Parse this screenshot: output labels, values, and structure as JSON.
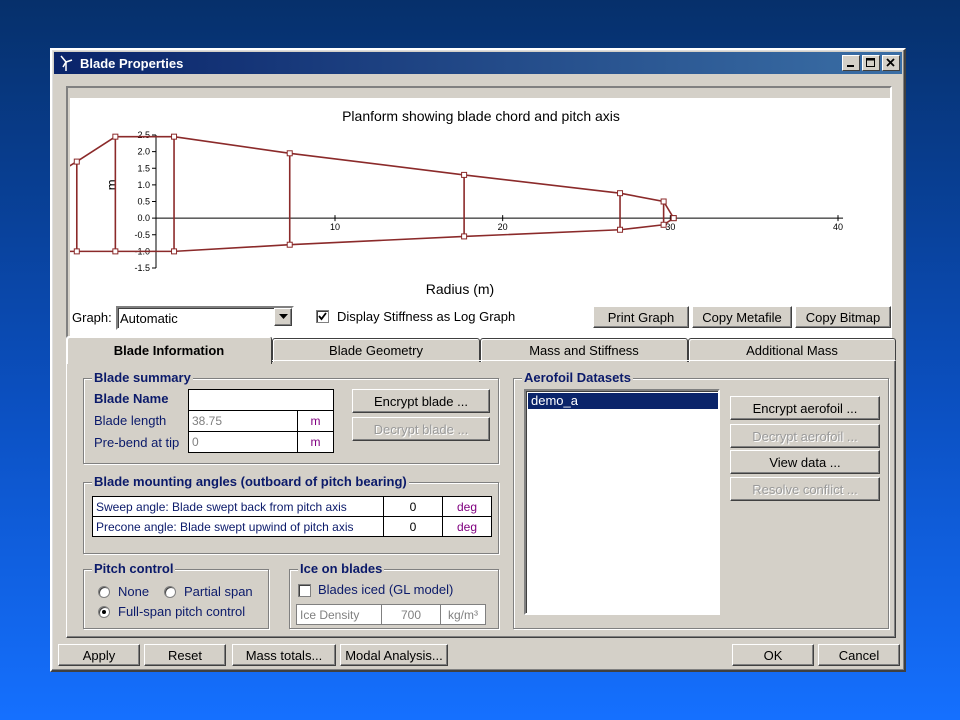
{
  "window": {
    "title": "Blade Properties"
  },
  "chart_data": {
    "type": "line",
    "title": "Planform showing blade chord and pitch axis",
    "xlabel": "Radius (m)",
    "ylabel": "m",
    "xlim": [
      0,
      40
    ],
    "ylim": [
      -1.5,
      2.5
    ],
    "x_ticks": [
      "10",
      "20",
      "30",
      "40"
    ],
    "y_ticks": [
      "2.5",
      "2.0",
      "1.5",
      "1.0",
      "0.5",
      "0.0",
      "-0.5",
      "-1.0",
      "-1.5"
    ],
    "series": [
      {
        "values": [
          [
            -8.8,
            1.0
          ],
          [
            -7.7,
            1.0
          ],
          [
            -5.4,
            1.7
          ],
          [
            -3.1,
            2.45
          ],
          [
            0.4,
            2.45
          ],
          [
            7.3,
            1.95
          ],
          [
            17.7,
            1.3
          ],
          [
            27.0,
            0.75
          ],
          [
            29.6,
            0.5
          ],
          [
            30.2,
            0.0
          ]
        ]
      },
      {
        "values": [
          [
            -8.8,
            -1.0
          ],
          [
            -7.7,
            -1.0
          ],
          [
            -5.4,
            -1.0
          ],
          [
            -3.1,
            -1.0
          ],
          [
            0.4,
            -1.0
          ],
          [
            7.3,
            -0.8
          ],
          [
            17.7,
            -0.55
          ],
          [
            27.0,
            -0.35
          ],
          [
            29.6,
            -0.2
          ],
          [
            30.2,
            0.0
          ]
        ]
      }
    ],
    "grid": false
  },
  "graph": {
    "label": "Graph:",
    "dropdown_value": "Automatic",
    "log_checkbox_label": "Display Stiffness as Log Graph",
    "log_checked": true,
    "print_button": "Print Graph",
    "copy_metafile_button": "Copy Metafile",
    "copy_bitmap_button": "Copy Bitmap"
  },
  "tabs": [
    "Blade Information",
    "Blade Geometry",
    "Mass and Stiffness",
    "Additional Mass"
  ],
  "blade_summary": {
    "title": "Blade summary",
    "name_label": "Blade Name",
    "name_value": "",
    "length_label": "Blade length",
    "length_value": "38.75",
    "length_unit": "m",
    "prebend_label": "Pre-bend at tip",
    "prebend_value": "0",
    "prebend_unit": "m",
    "encrypt_button": "Encrypt blade ...",
    "decrypt_button": "Decrypt blade ..."
  },
  "mounting": {
    "title": "Blade mounting angles (outboard of pitch bearing)",
    "sweep_label": "Sweep angle: Blade swept back from pitch axis",
    "sweep_value": "0",
    "sweep_unit": "deg",
    "precone_label": "Precone angle: Blade swept upwind of pitch axis",
    "precone_value": "0",
    "precone_unit": "deg"
  },
  "pitch_control": {
    "title": "Pitch control",
    "none": "None",
    "partial": "Partial span",
    "full": "Full-span pitch control"
  },
  "ice": {
    "title": "Ice on blades",
    "checkbox_label": "Blades iced (GL model)",
    "density_label": "Ice Density",
    "density_value": "700",
    "density_unit": "kg/m³"
  },
  "aerofoil": {
    "title": "Aerofoil Datasets",
    "items": [
      "demo_a"
    ],
    "encrypt_button": "Encrypt aerofoil ...",
    "decrypt_button": "Decrypt aerofoil ...",
    "view_button": "View data ...",
    "resolve_button": "Resolve conflict ..."
  },
  "footer": {
    "apply": "Apply",
    "reset": "Reset",
    "mass_totals": "Mass totals...",
    "modal": "Modal Analysis...",
    "ok": "OK",
    "cancel": "Cancel"
  }
}
